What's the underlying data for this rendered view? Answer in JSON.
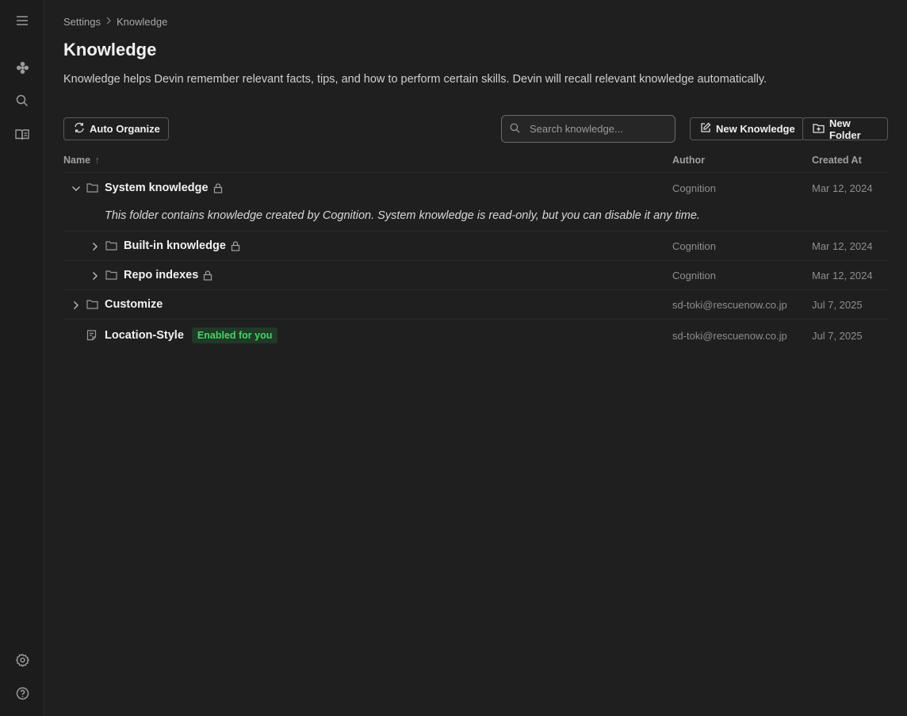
{
  "breadcrumb": {
    "parent": "Settings",
    "current": "Knowledge"
  },
  "page": {
    "title": "Knowledge",
    "description": "Knowledge helps Devin remember relevant facts, tips, and how to perform certain skills. Devin will recall relevant knowledge automatically."
  },
  "toolbar": {
    "auto_organize_label": "Auto Organize",
    "search_placeholder": "Search knowledge...",
    "new_knowledge_label": "New Knowledge",
    "new_folder_label": "New Folder"
  },
  "table": {
    "columns": {
      "name": "Name",
      "author": "Author",
      "created_at": "Created At"
    },
    "sort_indicator": "↑",
    "rows": [
      {
        "name": "System knowledge",
        "author": "Cognition",
        "created_at": "Mar 12, 2024",
        "type": "folder",
        "expanded": true,
        "locked": true,
        "note": "This folder contains knowledge created by Cognition. System knowledge is read-only, but you can disable it any time."
      },
      {
        "name": "Built-in knowledge",
        "author": "Cognition",
        "created_at": "Mar 12, 2024",
        "type": "folder",
        "expanded": false,
        "locked": true
      },
      {
        "name": "Repo indexes",
        "author": "Cognition",
        "created_at": "Mar 12, 2024",
        "type": "folder",
        "expanded": false,
        "locked": true
      },
      {
        "name": "Customize",
        "author": "sd-toki@rescuenow.co.jp",
        "created_at": "Jul 7, 2025",
        "type": "folder",
        "expanded": false,
        "locked": false
      },
      {
        "name": "Location-Style",
        "author": "sd-toki@rescuenow.co.jp",
        "created_at": "Jul 7, 2025",
        "type": "document",
        "badge": "Enabled for you"
      }
    ]
  },
  "sidebar": {
    "icons": [
      "menu-icon",
      "devin-logo-icon",
      "search-icon",
      "book-icon",
      "settings-icon",
      "help-icon"
    ]
  },
  "colors": {
    "background": "#1f1f1f",
    "badge_bg": "#1f3a26",
    "badge_text": "#4cd06a"
  }
}
